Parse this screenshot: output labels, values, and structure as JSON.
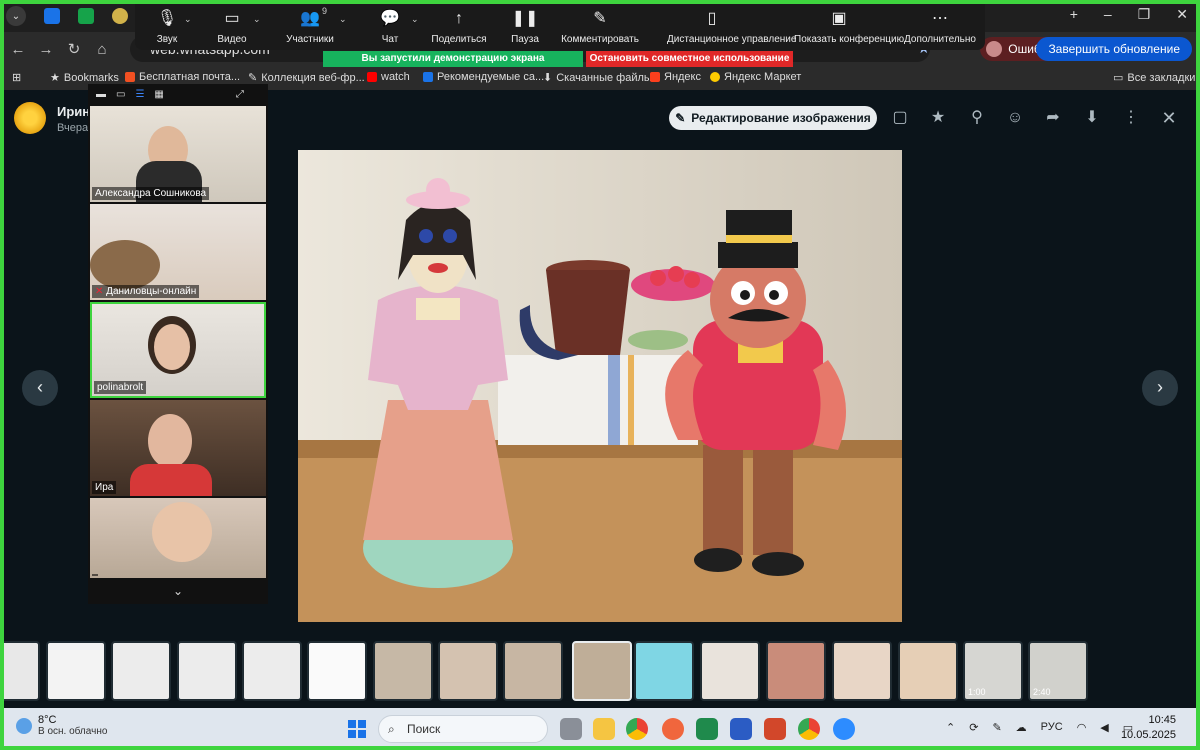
{
  "browser": {
    "url": "web.whatsapp.com",
    "error_label": "Ошибка",
    "update_label": "Завершить обновление",
    "bookmarks": [
      "Bookmarks",
      "Бесплатная почта...",
      "Коллекция веб-фр...",
      "watch",
      "Рекомендуемые са...",
      "Скачанные файлы",
      "Яндекс",
      "Яндекс Маркет"
    ],
    "all_bookmarks": "Все закладки"
  },
  "zoom_bar": {
    "buttons": [
      {
        "label": "Звук",
        "icon": "microphone-icon"
      },
      {
        "label": "Видео",
        "icon": "video-icon"
      },
      {
        "label": "Участники",
        "icon": "participants-icon",
        "badge": "9"
      },
      {
        "label": "Чат",
        "icon": "chat-icon"
      },
      {
        "label": "Поделиться",
        "icon": "share-screen-icon"
      },
      {
        "label": "Пауза",
        "icon": "pause-icon"
      },
      {
        "label": "Комментировать",
        "icon": "annotate-icon"
      },
      {
        "label": "Дистанционное управление",
        "icon": "remote-control-icon"
      },
      {
        "label": "Показать конференцию",
        "icon": "show-meeting-icon"
      },
      {
        "label": "Дополнительно",
        "icon": "more-icon"
      }
    ],
    "share_banner": "Вы запустили демонстрацию экрана",
    "stop_banner": "Остановить совместное использование"
  },
  "gallery": {
    "participants": [
      {
        "name": "Александра Сошникова"
      },
      {
        "name": "Даниловцы-онлайн"
      },
      {
        "name": "polinabrolt"
      },
      {
        "name": "Ира"
      },
      {
        "name": ""
      }
    ]
  },
  "viewer": {
    "sender_name": "Ирина",
    "sender_time": "Вчера",
    "edit_label": "Редактирование изображения",
    "thumbs": [
      {
        "type": "image"
      },
      {
        "type": "image"
      },
      {
        "type": "image"
      },
      {
        "type": "image"
      },
      {
        "type": "image"
      },
      {
        "type": "image"
      },
      {
        "type": "image"
      },
      {
        "type": "image"
      },
      {
        "type": "image"
      },
      {
        "type": "image",
        "selected": true
      },
      {
        "type": "image"
      },
      {
        "type": "image"
      },
      {
        "type": "image"
      },
      {
        "type": "image"
      },
      {
        "type": "image"
      },
      {
        "type": "video",
        "duration": "1:00"
      },
      {
        "type": "video",
        "duration": "2:40"
      }
    ]
  },
  "taskbar": {
    "temperature": "8°C",
    "weather": "В осн. облачно",
    "search_placeholder": "Поиск",
    "language": "РУС",
    "time": "10:45",
    "date": "10.05.2025"
  },
  "colors": {
    "whatsapp_bg": "#0b141a",
    "zoom_green": "#17b35d",
    "zoom_red": "#e02828",
    "border_green": "#3ed43e",
    "update_blue": "#0b57d0"
  }
}
